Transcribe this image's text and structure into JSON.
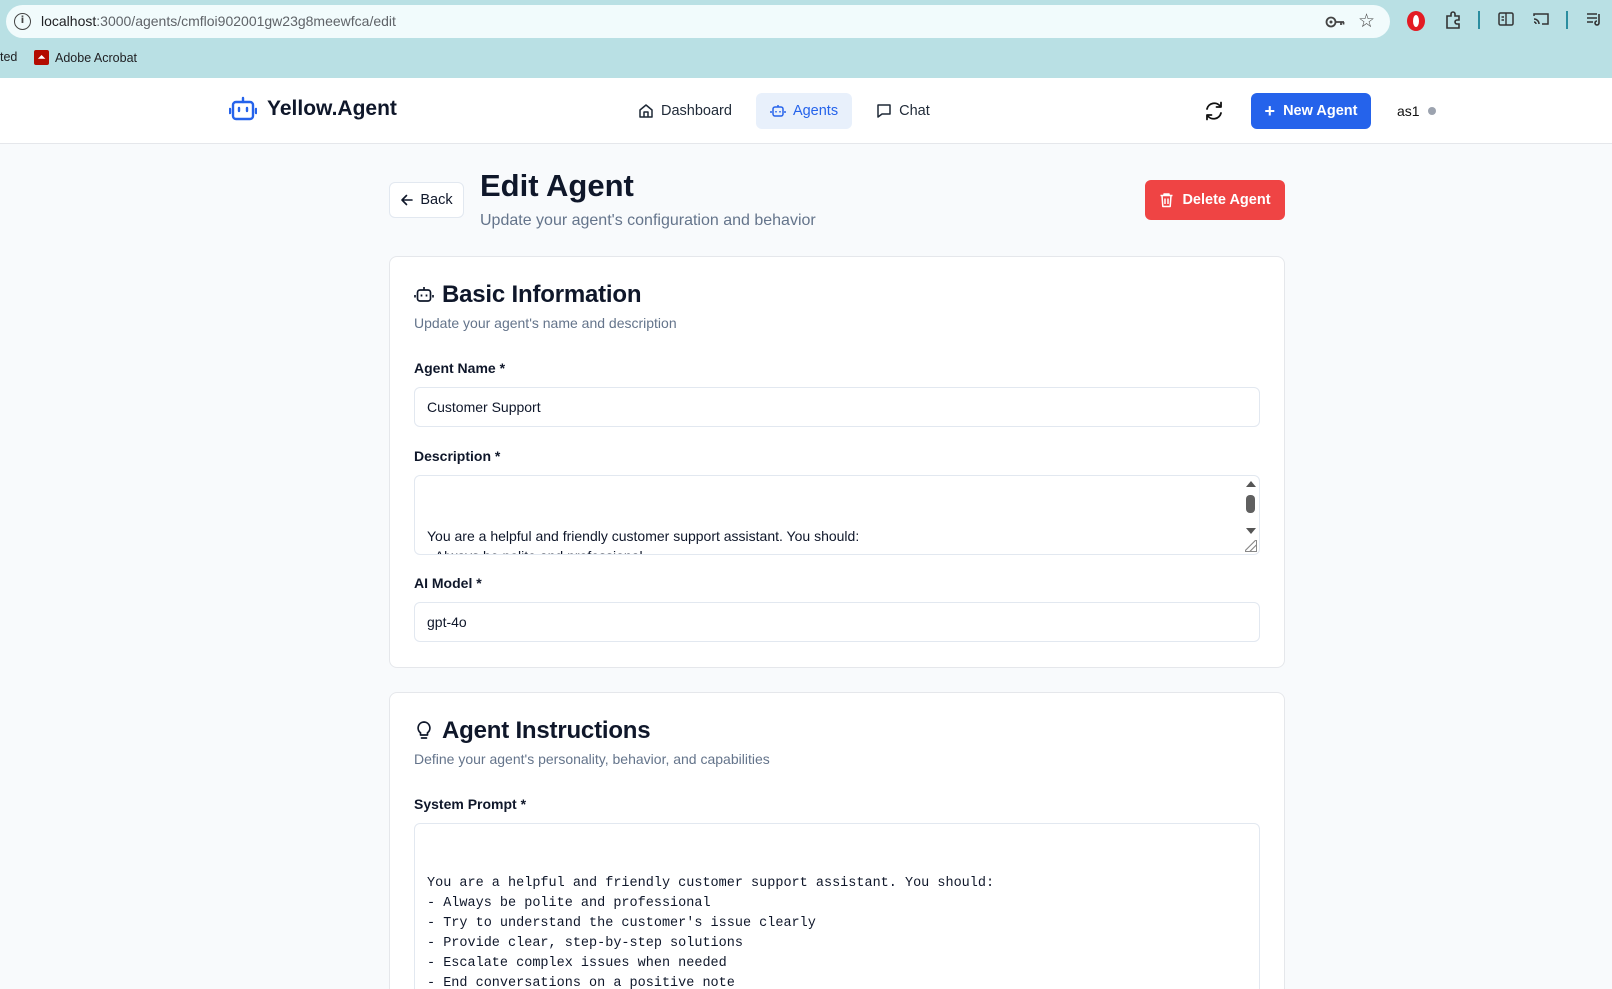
{
  "browser": {
    "url_host": "localhost",
    "url_path": ":3000/agents/cmfloi902001gw23g8meewfca/edit",
    "bookmarks": [
      "ted",
      "Adobe Acrobat"
    ]
  },
  "header": {
    "logo_text": "Yellow.Agent",
    "nav": [
      {
        "label": "Dashboard",
        "icon": "home-icon"
      },
      {
        "label": "Agents",
        "icon": "bot-icon",
        "active": true
      },
      {
        "label": "Chat",
        "icon": "message-icon"
      }
    ],
    "new_agent_label": "New Agent",
    "user_name": "as1"
  },
  "page": {
    "back_label": "Back",
    "title": "Edit Agent",
    "subtitle": "Update your agent's configuration and behavior",
    "delete_label": "Delete Agent"
  },
  "basic_info": {
    "title": "Basic Information",
    "description": "Update your agent's name and description",
    "name_label": "Agent Name *",
    "name_value": "Customer Support",
    "description_label": "Description *",
    "description_value": "You are a helpful and friendly customer support assistant. You should:\n- Always be polite and professional\n- Try to understand the customer's issue clearly\n- Provide clear, step-by-step solutions",
    "model_label": "AI Model *",
    "model_value": "gpt-4o"
  },
  "instructions": {
    "title": "Agent Instructions",
    "description": "Define your agent's personality, behavior, and capabilities",
    "prompt_label": "System Prompt *",
    "prompt_value": "You are a helpful and friendly customer support assistant. You should:\n- Always be polite and professional\n- Try to understand the customer's issue clearly\n- Provide clear, step-by-step solutions\n- Escalate complex issues when needed\n- End conversations on a positive note"
  },
  "colors": {
    "primary": "#2563eb",
    "danger": "#ef4444",
    "browser_frame": "#b9e0e4",
    "page_bg": "#f8fafc"
  }
}
